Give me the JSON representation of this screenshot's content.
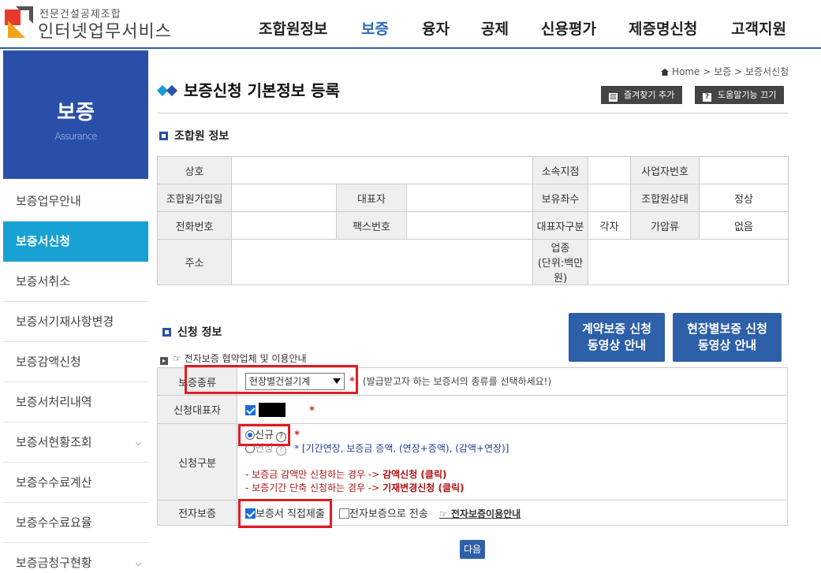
{
  "header": {
    "logo_small": "전문건설공제조합",
    "logo_big": "인터넷업무서비스",
    "nav": [
      {
        "label": "조합원정보",
        "active": false
      },
      {
        "label": "보증",
        "active": true
      },
      {
        "label": "융자",
        "active": false
      },
      {
        "label": "공제",
        "active": false
      },
      {
        "label": "신용평가",
        "active": false
      },
      {
        "label": "제증명신청",
        "active": false
      },
      {
        "label": "고객지원",
        "active": false
      }
    ]
  },
  "sidebar": {
    "title": "보증",
    "subtitle": "Assurance",
    "items": [
      {
        "label": "보증업무안내"
      },
      {
        "label": "보증서신청"
      },
      {
        "label": "보증서취소"
      },
      {
        "label": "보증서기재사항변경"
      },
      {
        "label": "보증감액신청"
      },
      {
        "label": "보증서처리내역"
      },
      {
        "label": "보증서현황조회"
      },
      {
        "label": "보증수수료계산"
      },
      {
        "label": "보증수수료요율"
      },
      {
        "label": "보증금청구현황"
      }
    ]
  },
  "breadcrumb": {
    "home": "Home",
    "sep1": ">",
    "level1": "보증",
    "sep2": ">",
    "level2": "보증서신청"
  },
  "page": {
    "title": "보증신청 기본정보 등록",
    "bookmark_button": "즐겨찾기 추가",
    "help_button": "도움말기능 끄기",
    "bookmark_icon": "bookmark-icon",
    "help_icon": "question-icon"
  },
  "member_info": {
    "section_title": "조합원 정보",
    "labels": {
      "company": "상호",
      "branch": "소속지점",
      "biz_no": "사업자번호",
      "join_date": "조합원가입일",
      "ceo": "대표자",
      "shares": "보유좌수",
      "status": "조합원상태",
      "phone": "전화번호",
      "fax": "팩스번호",
      "ceo_type": "대표자구분",
      "seizure": "가압류",
      "address": "주소",
      "industry_line1": "업종",
      "industry_line2": "(단위:백만원)"
    },
    "values": {
      "status": "정상",
      "ceo_type": "각자",
      "seizure": "없음"
    }
  },
  "apply_info": {
    "section_title": "신청 정보",
    "video_buttons": [
      {
        "line1": "계약보증 신청",
        "line2": "동영상 안내"
      },
      {
        "line1": "현장별보증 신청",
        "line2": "동영상 안내"
      }
    ],
    "e_guide_link": "☞ 전자보증 협약업체 및 이용안내",
    "rows": {
      "type_label": "보증종류",
      "type_value": "현장별건설기계",
      "type_hint": "(발급받고자 하는 보증서의 종류를 선택하세요!)",
      "rep_label": "신청대표자",
      "kind_label": "신청구분",
      "kind_new": "신규",
      "kind_ext": "연장",
      "kind_ext_note": "* [기간연장, 보증금 증액, (연장+증액), (감액+연장)]",
      "note1_prefix": "- 보증금 감액만 신청하는 경우 -> ",
      "note1_bold": "감액신청 (클릭)",
      "note2_prefix": "- 보증기간 단축 신청하는 경우 -> ",
      "note2_bold": "기재변경신청 (클릭)",
      "e_label": "전자보증",
      "e_direct": "보증서 직접제출",
      "e_send": "전자보증으로 전송",
      "e_guide": "☞ 전자보증이용안내"
    },
    "next_button": "다음",
    "required_mark": "*"
  },
  "colors": {
    "brand": "#2a4fa8",
    "active_menu": "#18a1d3",
    "highlight": "#e01b23"
  }
}
